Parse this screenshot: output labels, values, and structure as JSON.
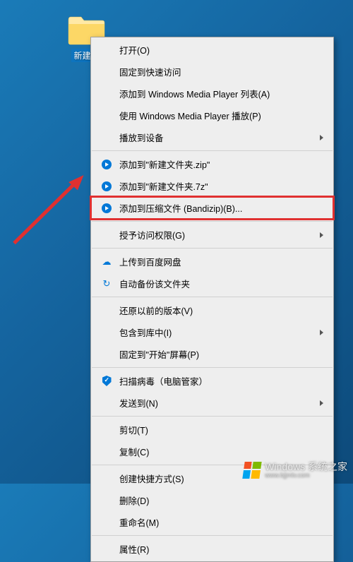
{
  "desktopIcon": {
    "label": "新建文"
  },
  "menu": {
    "open": "打开(O)",
    "pinQuick": "固定到快速访问",
    "addToWmpList": "添加到 Windows Media Player 列表(A)",
    "playWmp": "使用 Windows Media Player 播放(P)",
    "castTo": "播放到设备",
    "addZip": "添加到\"新建文件夹.zip\"",
    "add7z": "添加到\"新建文件夹.7z\"",
    "addBandizip": "添加到压缩文件 (Bandizip)(B)...",
    "grantAccess": "授予访问权限(G)",
    "baiduUpload": "上传到百度网盘",
    "autoBackup": "自动备份该文件夹",
    "prevVersions": "还原以前的版本(V)",
    "addToLib": "包含到库中(I)",
    "pinStart": "固定到\"开始\"屏幕(P)",
    "scanVirus": "扫描病毒（电脑管家）",
    "sendTo": "发送到(N)",
    "cut": "剪切(T)",
    "copy": "复制(C)",
    "createShortcut": "创建快捷方式(S)",
    "delete": "删除(D)",
    "rename": "重命名(M)",
    "properties": "属性(R)"
  },
  "watermark": {
    "main": "Windows 系统之家",
    "sub": "www.bjjmlv.com"
  }
}
